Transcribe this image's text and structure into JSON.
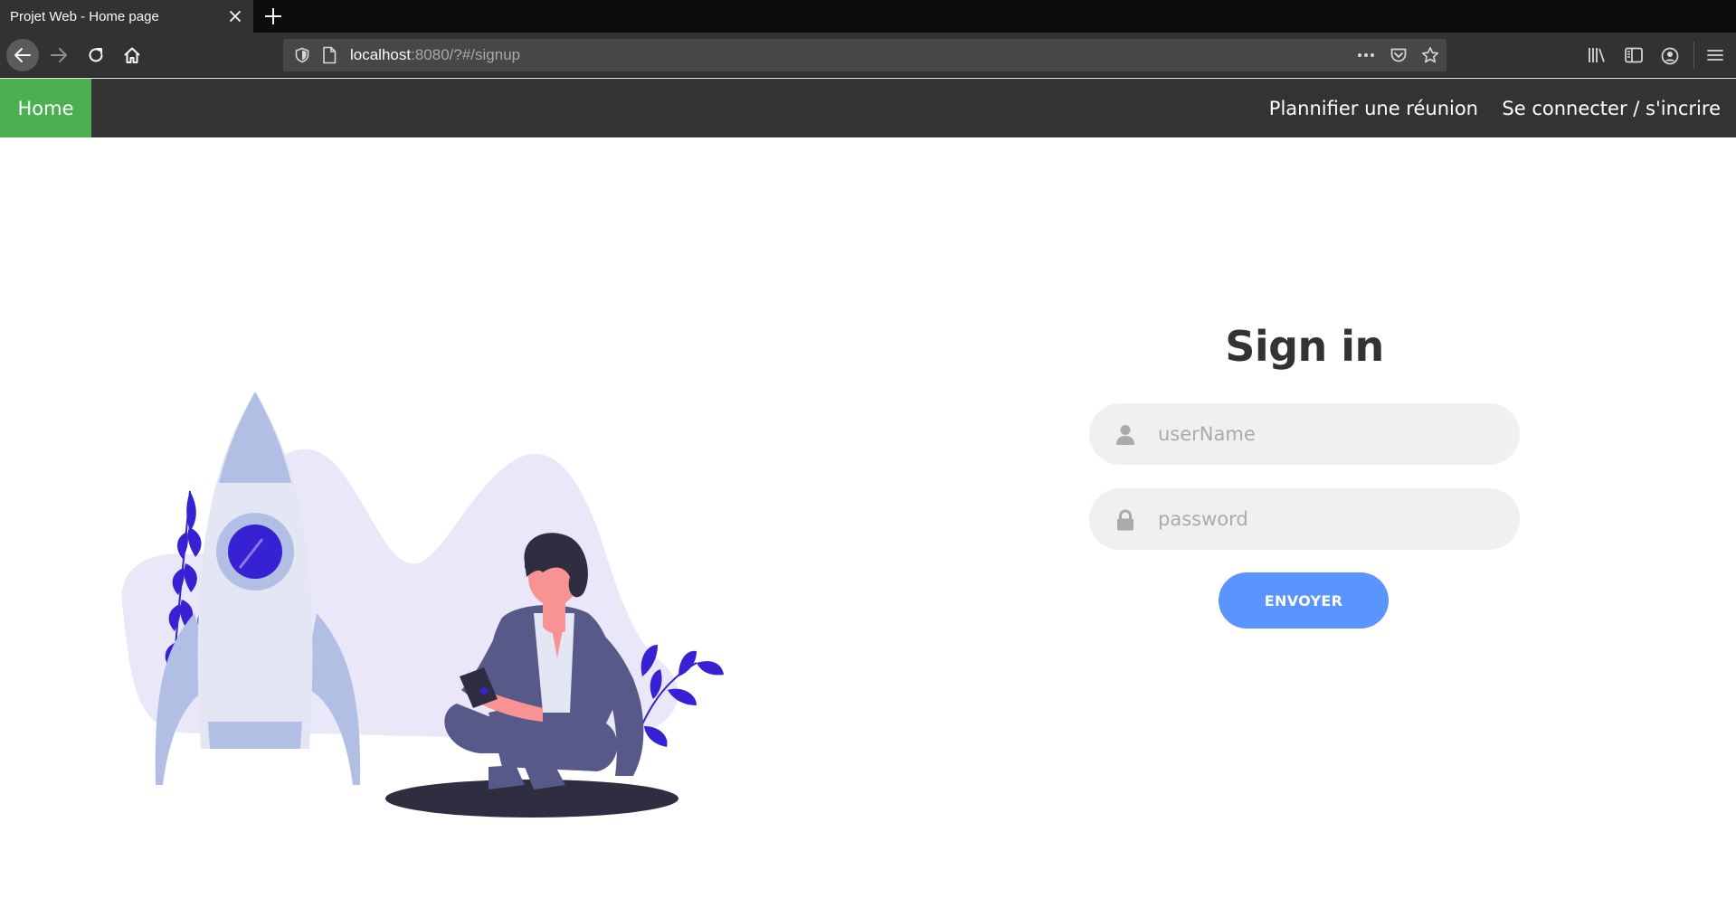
{
  "browser": {
    "tab_title": "Projet Web - Home page",
    "url_host": "localhost",
    "url_rest": ":8080/?#/signup"
  },
  "site_nav": {
    "home_label": "Home",
    "plan_label": "Plannifier une réunion",
    "login_label": "Se connecter / s'incrire"
  },
  "form": {
    "title": "Sign in",
    "username_placeholder": "userName",
    "password_placeholder": "password",
    "submit_label": "ENVOYER"
  },
  "colors": {
    "accent_home": "#4caf50",
    "button": "#5995fd",
    "nav_bg": "#333333",
    "field_bg": "#f0f0f0"
  },
  "icons": {
    "username_icon": "user-icon",
    "password_icon": "lock-icon"
  }
}
